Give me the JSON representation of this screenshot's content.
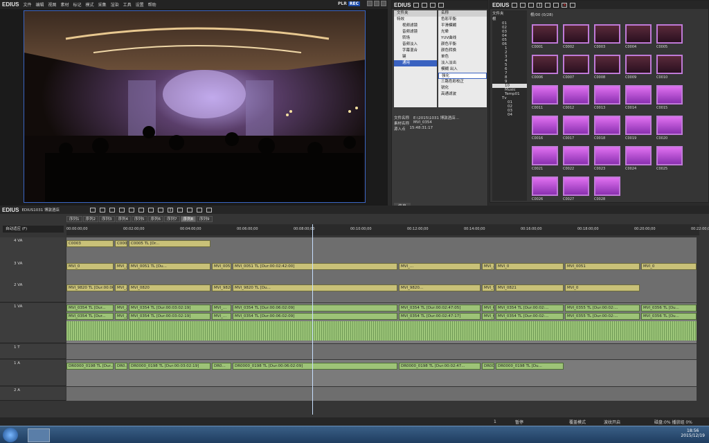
{
  "app": {
    "name": "EDIUS",
    "plr": "PLR",
    "rec": "REC",
    "menus": [
      "文件",
      "编辑",
      "视图",
      "素材",
      "标记",
      "模式",
      "采集",
      "渲染",
      "工具",
      "设置",
      "帮助"
    ]
  },
  "bin": {
    "title": "EDIUS",
    "tree_title": "文件夹",
    "tree": [
      "根",
      "01",
      "02",
      "03",
      "04",
      "05",
      "06",
      "1",
      "2",
      "3",
      "4",
      "5",
      "6",
      "7",
      "8",
      "9",
      "10",
      "Music",
      "Temp01",
      "Tv",
      "01",
      "02",
      "03",
      "04"
    ],
    "counter": "根/00 (0/28)",
    "clips": [
      "C0001",
      "C0002",
      "C0003",
      "C0004",
      "C0005",
      "C0006",
      "C0007",
      "C0008",
      "C0009",
      "C0010",
      "C0011",
      "C0012",
      "C0013",
      "C0014",
      "C0015",
      "C0016",
      "C0017",
      "C0018",
      "C0019",
      "C0020",
      "C0021",
      "C0022",
      "C0023",
      "C0024",
      "C0025",
      "C0026",
      "C0027",
      "C0028"
    ]
  },
  "effect": {
    "title": "EDIUS",
    "col_name": "名称",
    "tree": [
      "特效",
      "视频滤镜",
      "音频滤镜",
      "转场",
      "音频淡入",
      "字幕混合",
      "键",
      "通用"
    ],
    "list": [
      "色彩平衡",
      "平滑模糊",
      "光晕",
      "YUV曲线",
      "颜色平衡",
      "颜色转换",
      "单色",
      "淡入淡出",
      "模糊 出入",
      "强化",
      "三路色彩校正",
      "锐化",
      "高通滤波"
    ],
    "info_labels": [
      "文件名称",
      "素材名称",
      "源入点"
    ],
    "info_values": [
      "E:\\2015\\1031 博敦酒店...",
      "MVI_0354",
      "15:48:31:17"
    ],
    "tab": "信息"
  },
  "timeline": {
    "title": "EDIUS",
    "project": "EDIUS1031 博敦酒店",
    "seq_tabs": [
      "序列1",
      "序列2",
      "序列3",
      "序列4",
      "序列5",
      "序列6",
      "序列7",
      "序列8",
      "序列9"
    ],
    "active_tab": 7,
    "timecodes": [
      "00:00:00;00",
      "00:02:00;00",
      "00:04:00;00",
      "00:06:00;00",
      "00:08:00;00",
      "00:10:00;00",
      "00:12:00;00",
      "00:14:00;00",
      "00:16:00;00",
      "00:18:00;00",
      "00:20:00;00",
      "00:22:00;00"
    ],
    "mode": "自动适应 (F)",
    "tracks": [
      "4 VA",
      "3 VA",
      "2 VA",
      "1 VA",
      "1 T",
      "1 A",
      "2 A"
    ],
    "vol": "VOL",
    "clips4": [
      "C0003",
      "C0005  TL [Du...",
      "C0005  TL [Dr..."
    ],
    "clips3": [
      "MVI_0",
      "MVI_...",
      "MVI_0051  TL [Du...",
      "MVI_0051  TL [Dur:00:02:41:17]",
      "MVI_0051  TL [Dur:00:02:42:00]",
      "MVI_...",
      "MVI_...",
      "MVI_0",
      "MVI_0051",
      "MVI_0"
    ],
    "clips2": [
      "MVI_9820  TL [Dur:00:00:...",
      "MVI_...",
      "MVI_0820",
      "MVI_9820",
      "MVI_9820  TL [Du...",
      "MVI_9820...",
      "MVI_9820  TL [Dur:0...",
      "MVI_0821",
      "MVI_0"
    ],
    "clips1": [
      "MVI_0354  TL [Dur...",
      "MVI_...",
      "MVI_0354  TL [Dur:00:03:02:19]",
      "MVI_...",
      "MVI_0354  TL [Dur:00:06:02:09]",
      "MVI_0354  TL [Dur:00:02:47:05]",
      "MVI_0354",
      "MVI_0354  TL [Dur:00:02:...",
      "MVI_0355  TL [Dur:00:02:...",
      "MVI_0356  TL [Du..."
    ],
    "clips1b": [
      "MVI_0354  TL [Dur...",
      "MVI_...",
      "MVI_0354  TL [Dur:00:03:02:19]",
      "MVI_...",
      "MVI_0354  TL [Dur:00:06:02:09]",
      "MVI_0354  TL [Dur:00:02:47:17]",
      "MVI_0354",
      "MVI_0354  TL [Dur:00:02:...",
      "MVI_0355  TL [Dur:00:02:...",
      "MVI_0356  TL [Du..."
    ],
    "audio": [
      "DR0000_0198  TL [Dur...",
      "DR0...",
      "DR0000_0198  TL [Dur:00:03:02:19]",
      "DR0...",
      "DR0000_0198  TL [Dur:00:06:02:09]",
      "DR0000_0198  TL [Dur:00:02:47...",
      "DR0000_0198  TL [Dur:00:05:47:23]",
      "DR0000_0198  TL [Du..."
    ]
  },
  "status": {
    "num": "1",
    "items": [
      "暂停",
      "覆盖模式",
      "波纹开启",
      "磁盘:0% 播放组 0%"
    ]
  },
  "taskbar": {
    "time": "18:56",
    "date": "2015/12/19"
  }
}
